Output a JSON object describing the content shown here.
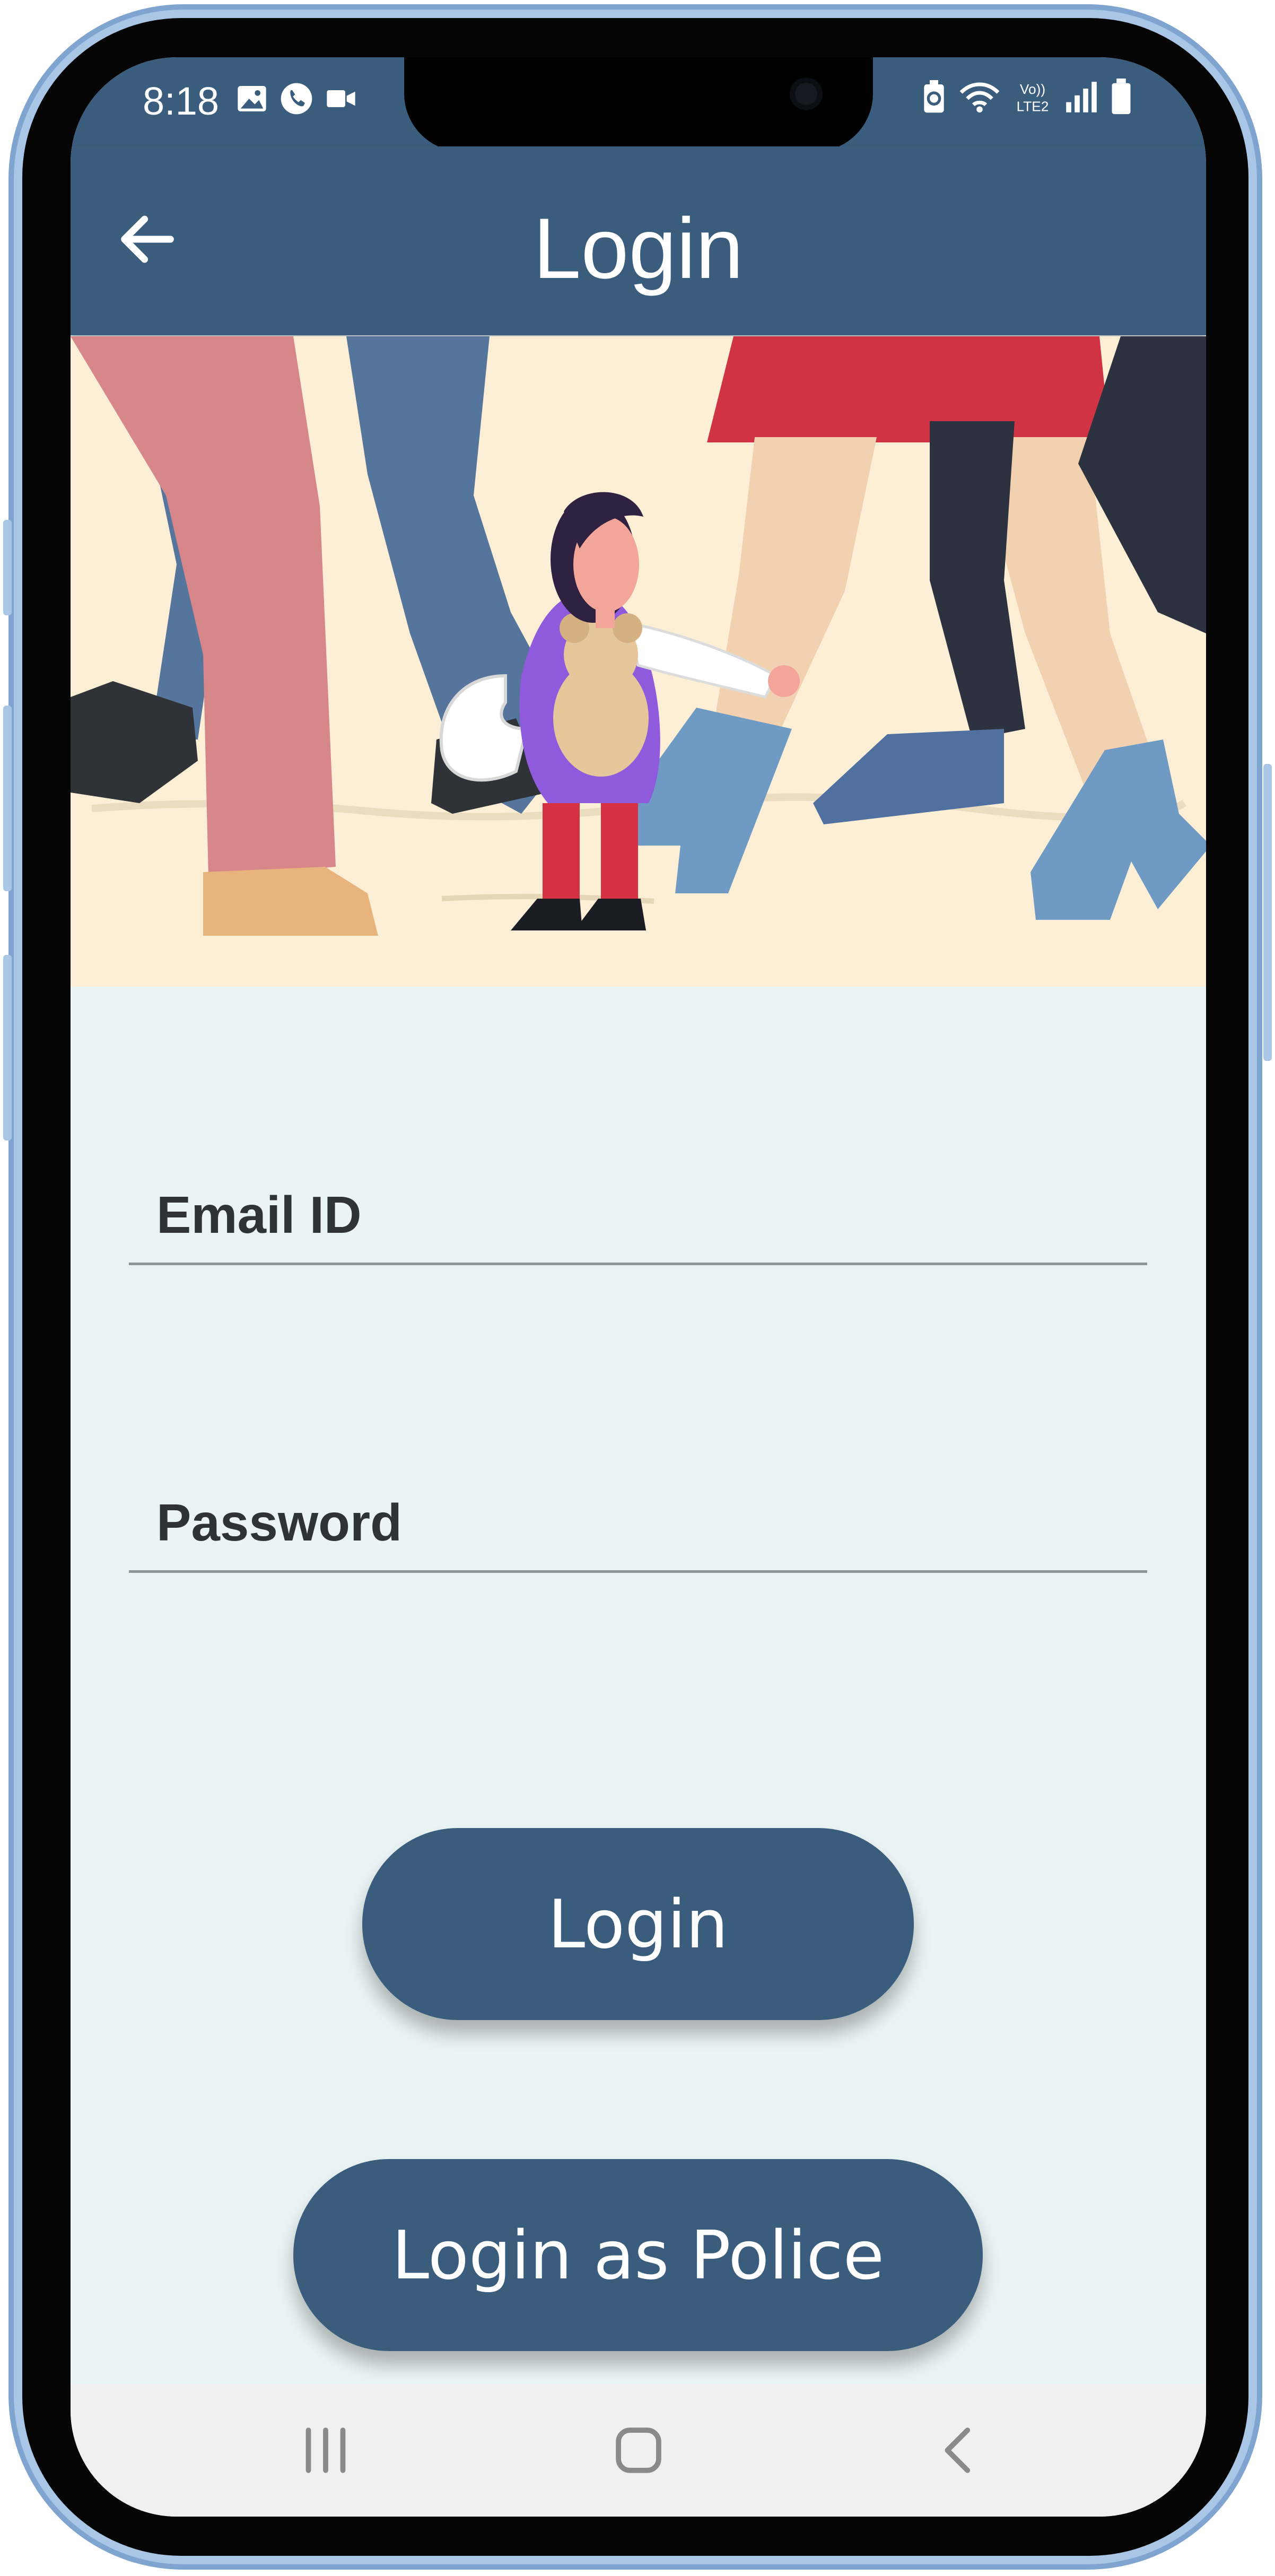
{
  "status_bar": {
    "time": "8:18",
    "left_icons": [
      "image-icon",
      "phone-icon",
      "video-icon"
    ],
    "right_icons": [
      "battery-saver-icon",
      "wifi-icon",
      "volte-icon",
      "signal-icon",
      "battery-icon"
    ],
    "volte_label": "Vo))\nLTE2"
  },
  "app_bar": {
    "title": "Login",
    "back_icon": "arrow-left-icon",
    "background": "#3a5d7d"
  },
  "hero": {
    "illustration": "child-among-crowd-illustration"
  },
  "form": {
    "email_label": "Email ID",
    "email_value": "",
    "password_label": "Password",
    "password_value": ""
  },
  "buttons": {
    "login": "Login",
    "login_police": "Login as Police"
  },
  "nav_bar": {
    "items": [
      "recents-icon",
      "home-icon",
      "back-icon"
    ]
  },
  "colors": {
    "primary": "#3a5d7d",
    "form_background": "#eaf4f4",
    "hero_background": "#fcefd6",
    "label_text": "#2e3338"
  }
}
